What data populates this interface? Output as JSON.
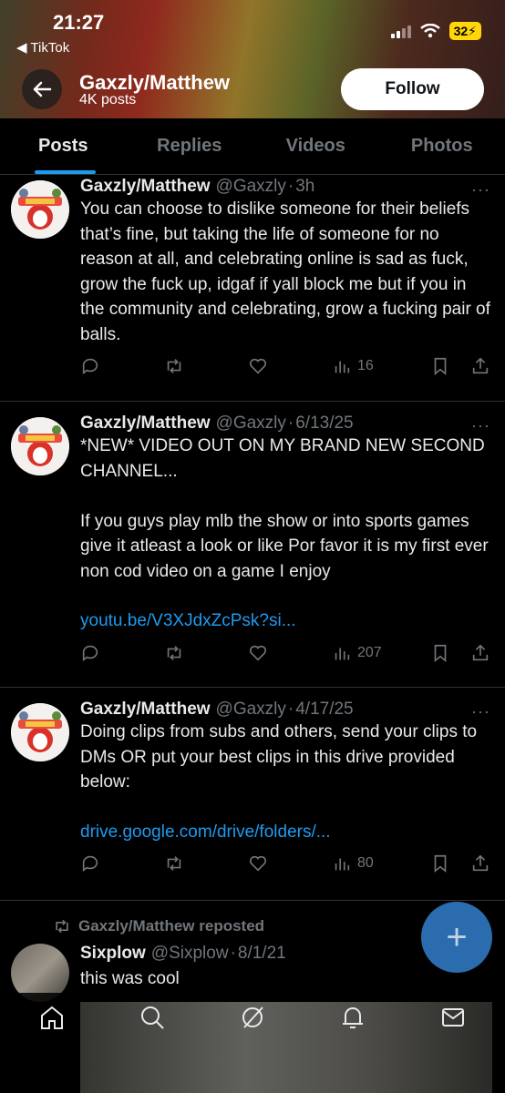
{
  "status_bar": {
    "time": "21:27",
    "back_app": "◀ TikTok",
    "battery": "32"
  },
  "header": {
    "name": "Gaxzly/Matthew",
    "post_count": "4K posts",
    "follow_label": "Follow"
  },
  "tabs": [
    {
      "label": "Posts"
    },
    {
      "label": "Replies"
    },
    {
      "label": "Videos"
    },
    {
      "label": "Photos"
    }
  ],
  "posts": [
    {
      "name": "Gaxzly/Matthew",
      "handle": "@Gaxzly",
      "sep": "·",
      "time": "3h",
      "text": "You can choose to dislike someone for their beliefs that’s fine, but taking the life of someone for no reason at all, and celebrating online is sad as fuck, grow the fuck up, idgaf if yall block me but if you in the community and celebrating, grow a fucking pair of balls.",
      "link": "",
      "views": "16"
    },
    {
      "name": "Gaxzly/Matthew",
      "handle": "@Gaxzly",
      "sep": "·",
      "time": "6/13/25",
      "text": "*NEW* VIDEO OUT ON MY BRAND NEW SECOND CHANNEL...\n\nIf you guys play mlb the show or into sports games give it atleast a look or like Por favor it is my first ever non cod video on a game I enjoy",
      "link": "youtu.be/V3XJdxZcPsk?si...",
      "views": "207"
    },
    {
      "name": "Gaxzly/Matthew",
      "handle": "@Gaxzly",
      "sep": "·",
      "time": "4/17/25",
      "text": "Doing clips from subs and others, send your clips to DMs OR put your best clips in this drive provided below:",
      "link": "drive.google.com/drive/folders/...",
      "views": "80"
    }
  ],
  "repost": {
    "label": "Gaxzly/Matthew reposted",
    "name": "Sixplow",
    "handle": "@Sixplow",
    "sep": "·",
    "time": "8/1/21",
    "text": "this was cool"
  },
  "fab_symbol": "+",
  "more_symbol": "···"
}
